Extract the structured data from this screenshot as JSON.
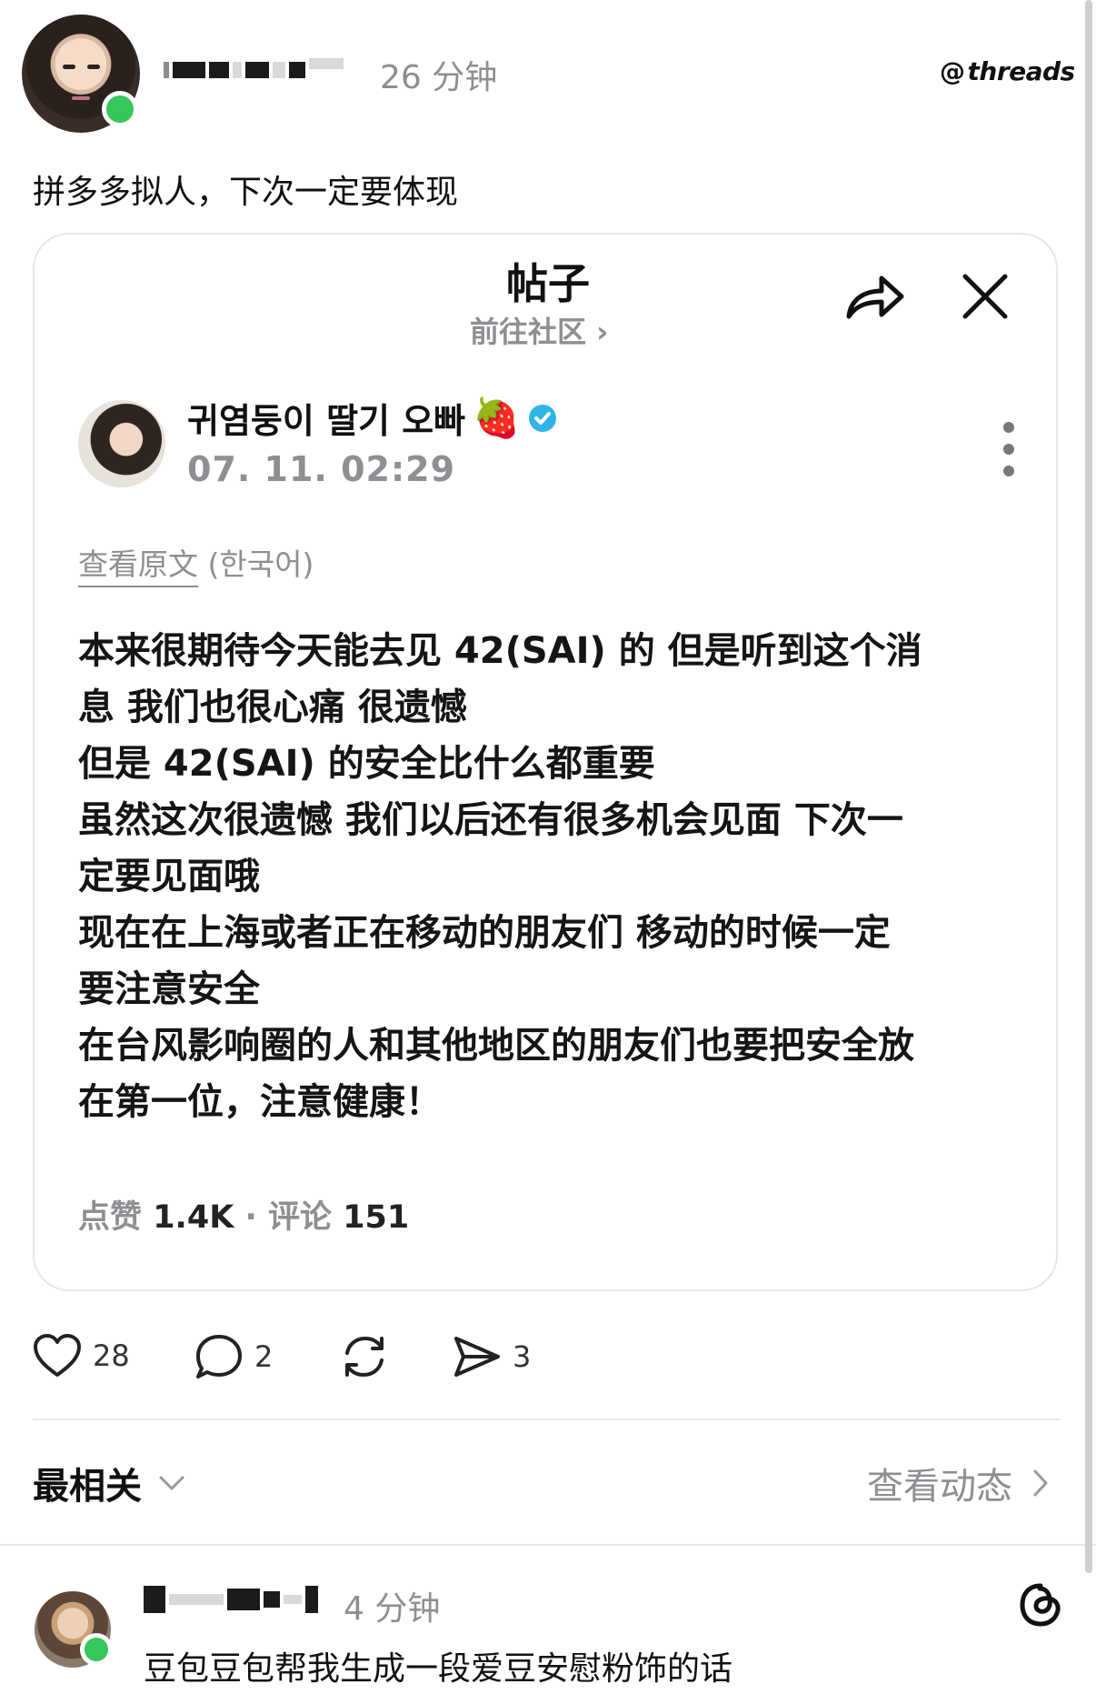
{
  "post": {
    "time": "26 分钟",
    "brand": "threads",
    "text": "拼多多拟人，下次一定要体现"
  },
  "card": {
    "title": "帖子",
    "community_link": "前往社区 ›",
    "author_name": "귀염둥이 딸기 오빠",
    "author_emoji": "🍓",
    "timestamp": "07. 11. 02:29",
    "view_original": "查看原文",
    "original_lang": "(한국어)",
    "body_lines": [
      "本来很期待今天能去见 42(SAI) 的 但是听到这个消",
      "息 我们也很心痛 很遗憾",
      "但是 42(SAI) 的安全比什么都重要",
      "虽然这次很遗憾 我们以后还有很多机会见面 下次一",
      "定要见面哦",
      "现在在上海或者正在移动的朋友们 移动的时候一定",
      "要注意安全",
      "在台风影响圈的人和其他地区的朋友们也要把安全放",
      "在第一位，注意健康！"
    ],
    "likes_label": "点赞",
    "likes_value": "1.4K",
    "comments_label": "评论",
    "comments_value": "151"
  },
  "actions": {
    "like_count": "28",
    "comment_count": "2",
    "share_count": "3"
  },
  "sort": {
    "label": "最相关",
    "view_activity": "查看动态"
  },
  "reply": {
    "time": "4 分钟",
    "text": "豆包豆包帮我生成一段爱豆安慰粉饰的话"
  },
  "colors": {
    "online": "#36c75a",
    "verified": "#2fb4e8",
    "muted": "#8e8e93"
  }
}
